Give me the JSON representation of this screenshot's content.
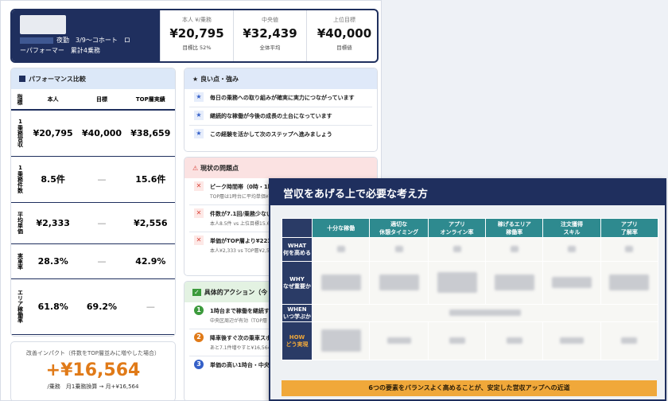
{
  "header": {
    "subtitle_line1": "夜勤　3/9〜コホート　ロ",
    "subtitle_line2": "ーパフォーマー　累計4乗務",
    "stats": [
      {
        "label": "本人 ¥/乗務",
        "value": "¥20,795",
        "sub": "目標比 52%"
      },
      {
        "label": "中央値",
        "value": "¥32,439",
        "sub": "全体平均"
      },
      {
        "label": "上位目標",
        "value": "¥40,000",
        "sub": "目標値"
      }
    ]
  },
  "performance": {
    "title": "パフォーマンス比較",
    "columns": [
      "指標",
      "本人",
      "目標",
      "TOP層実績"
    ],
    "rows": [
      {
        "label": "1乗務営収",
        "self": "¥20,795",
        "target": "¥40,000",
        "top": "¥38,659"
      },
      {
        "label": "1乗務件数",
        "self": "8.5件",
        "target": "—",
        "top": "15.6件"
      },
      {
        "label": "平均単価",
        "self": "¥2,333",
        "target": "—",
        "top": "¥2,556"
      },
      {
        "label": "実車率",
        "self": "28.3%",
        "target": "—",
        "top": "42.9%"
      },
      {
        "label": "エリア稼働率",
        "self": "61.8%",
        "target": "69.2%",
        "top": "—"
      }
    ]
  },
  "impact": {
    "title": "改善インパクト（件数をTOP層並みに増やした場合）",
    "value": "+¥16,564",
    "sub": "/乗務　月1乗務換算 → 月+¥16,564"
  },
  "strengths": {
    "title": "良い点・強み",
    "items": [
      "毎日の乗務への取り組みが確実に実力につながっています",
      "継続的な稼働が今後の成長の土台になっています",
      "この経験を活かして次のステップへ進みましょう"
    ]
  },
  "issues": {
    "title": "現状の問題点",
    "items": [
      {
        "text": "ピーク時間帯（0時・1時",
        "sub": "TOP層は1時台に平均単価¥"
      },
      {
        "text": "件数が7.1回/乗務少ない",
        "sub": "本人8.5件 vs 上位目標15.6"
      },
      {
        "text": "単価がTOP層より¥223",
        "sub": "本人¥2,333 vs TOP層¥2,5"
      }
    ]
  },
  "actions": {
    "title": "具体的アクション（今",
    "items": [
      {
        "num": "1",
        "text": "1時台まで稼働を継続する",
        "sub": "中央区周辺が有効（TOP層"
      },
      {
        "num": "2",
        "text": "降車後すぐ次の乗車スポッ",
        "sub": "あと7.1件増やすと¥16,564"
      },
      {
        "num": "3",
        "text": "単価の高い1時台・中央区",
        "sub": ""
      }
    ]
  },
  "overlay": {
    "title": "営収をあげる上で必要な考え方",
    "columns": [
      "十分な稼働",
      "適切な\n休憩タイミング",
      "アプリ\nオンライン率",
      "稼げるエリア\n稼働率",
      "注文獲得\nスキル",
      "アプリ\n了解率"
    ],
    "rows": [
      {
        "label": "WHAT\n何を高める"
      },
      {
        "label": "WHY\nなぜ重要か"
      },
      {
        "label": "WHEN\nいつ学ぶか"
      },
      {
        "label": "HOW\nどう実現"
      }
    ],
    "footer": "6つの要素をバランスよく高めることが、安定した営収アップへの近道"
  },
  "colors": {
    "navy": "#1f2f5e",
    "teal": "#2e8a8f",
    "orange": "#e07a18",
    "amber": "#f0a83a"
  }
}
